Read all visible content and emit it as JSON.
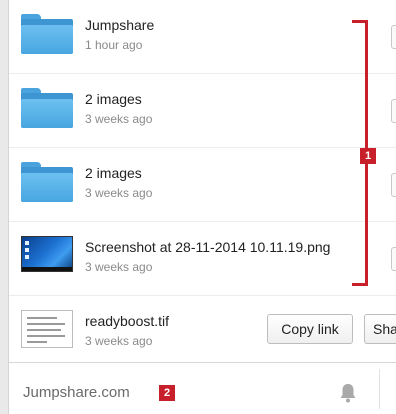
{
  "files": [
    {
      "name": "Jumpshare",
      "time": "1 hour ago",
      "icon": "folder-icon"
    },
    {
      "name": "2 images",
      "time": "3 weeks ago",
      "icon": "folder-icon"
    },
    {
      "name": "2 images",
      "time": "3 weeks ago",
      "icon": "folder-icon"
    },
    {
      "name": "Screenshot at 28-11-2014 10.11.19.png",
      "time": "3 weeks ago",
      "icon": "screenshot-thumbnail"
    },
    {
      "name": "readyboost.tif",
      "time": "3 weeks ago",
      "icon": "document-thumbnail"
    }
  ],
  "actions": {
    "copy_link": "Copy link",
    "share": "Sha"
  },
  "annotations": {
    "badge1": "1",
    "badge2": "2",
    "color": "#c8202a"
  },
  "footer": {
    "site": "Jumpshare.com",
    "icon": "bell-icon"
  }
}
